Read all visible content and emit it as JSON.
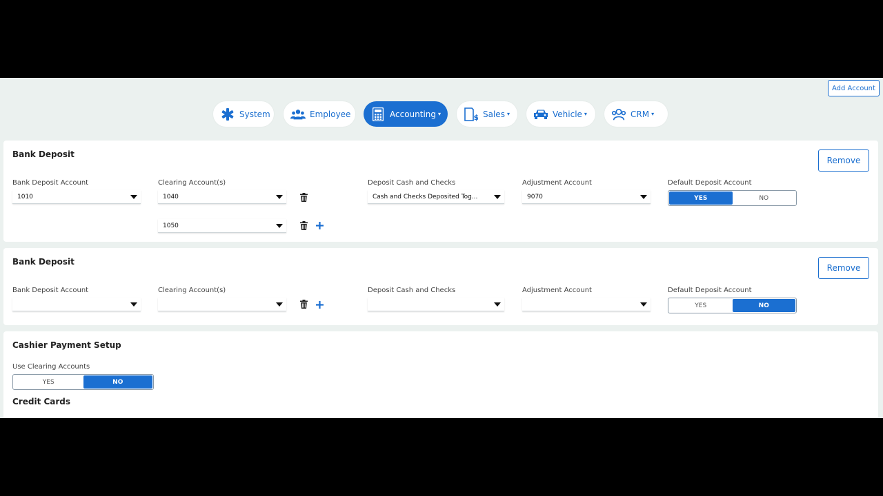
{
  "header": {
    "add_account_label": "Add Account"
  },
  "nav": {
    "tabs": [
      {
        "label": "System",
        "icon": "asterisk-icon"
      },
      {
        "label": "Employee",
        "icon": "users-icon"
      },
      {
        "label": "Accounting",
        "icon": "calculator-icon",
        "active": true
      },
      {
        "label": "Sales",
        "icon": "invoice-icon"
      },
      {
        "label": "Vehicle",
        "icon": "car-icon"
      },
      {
        "label": "CRM",
        "icon": "group-icon"
      }
    ],
    "caret": "▾"
  },
  "bank_deposit_1": {
    "title": "Bank Deposit",
    "remove_label": "Remove",
    "labels": {
      "bank_deposit_account": "Bank Deposit Account",
      "clearing_accounts": "Clearing Account(s)",
      "deposit_cash_checks": "Deposit Cash and Checks",
      "adjustment_account": "Adjustment Account",
      "default_deposit_account": "Default Deposit Account"
    },
    "values": {
      "bank_deposit_account": "1010",
      "clearing_account_1": "1040",
      "clearing_account_2": "1050",
      "deposit_cash_checks": "Cash and Checks Deposited Tog...",
      "adjustment_account": "9070"
    },
    "toggle": {
      "yes": "YES",
      "no": "NO",
      "selected": "YES"
    }
  },
  "bank_deposit_2": {
    "title": "Bank Deposit",
    "remove_label": "Remove",
    "labels": {
      "bank_deposit_account": "Bank Deposit Account",
      "clearing_accounts": "Clearing Account(s)",
      "deposit_cash_checks": "Deposit Cash and Checks",
      "adjustment_account": "Adjustment Account",
      "default_deposit_account": "Default Deposit Account"
    },
    "values": {
      "bank_deposit_account": "",
      "clearing_account_1": "",
      "deposit_cash_checks": "",
      "adjustment_account": ""
    },
    "toggle": {
      "yes": "YES",
      "no": "NO",
      "selected": "NO"
    }
  },
  "cashier": {
    "title": "Cashier Payment Setup",
    "use_clearing_label": "Use Clearing Accounts",
    "toggle": {
      "yes": "YES",
      "no": "NO",
      "selected": "NO"
    },
    "credit_cards_title": "Credit Cards"
  },
  "colors": {
    "accent": "#1b6fd1",
    "background": "#ebf1ef"
  }
}
